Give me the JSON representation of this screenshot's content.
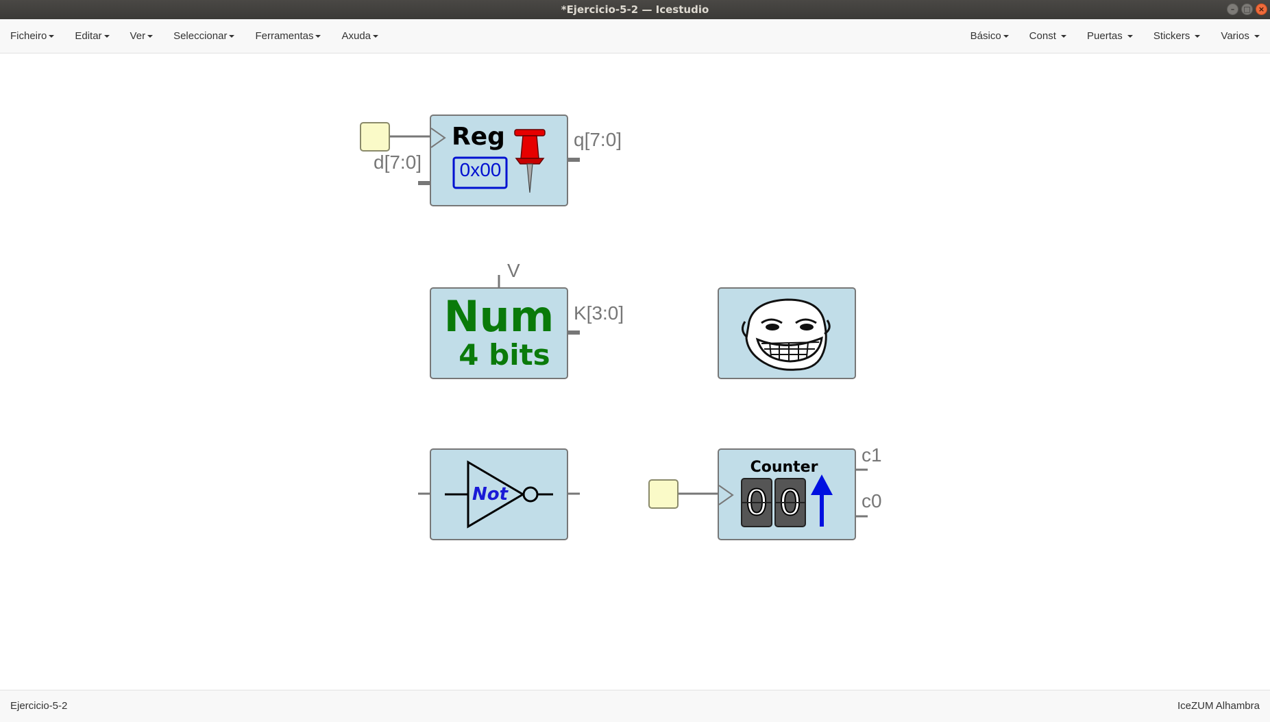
{
  "window": {
    "title": "*Ejercicio-5-2 — Icestudio"
  },
  "menu_left": [
    "Ficheiro",
    "Editar",
    "Ver",
    "Seleccionar",
    "Ferramentas",
    "Axuda"
  ],
  "menu_right": [
    "Básico",
    "Const",
    "Puertas",
    "Stickers",
    "Varios"
  ],
  "canvas": {
    "reg_block": {
      "title": "Reg",
      "value": "0x00",
      "input_label": "d[7:0]",
      "output_label": "q[7:0]"
    },
    "num_block": {
      "line1": "Num",
      "line2": "4 bits",
      "param_label": "V",
      "output_label": "K[3:0]"
    },
    "not_block": {
      "label": "Not"
    },
    "counter_block": {
      "title": "Counter",
      "digit1": "0",
      "digit2": "0",
      "out1": "c1",
      "out0": "c0"
    }
  },
  "status": {
    "left": "Ejercicio-5-2",
    "right": "IceZUM Alhambra"
  },
  "colors": {
    "block_fill": "#c1dde8",
    "pin_fill": "#fafac8",
    "num_green": "#0a7a0a",
    "not_blue": "#1a1ad6",
    "reg_blue": "#0010d0"
  }
}
